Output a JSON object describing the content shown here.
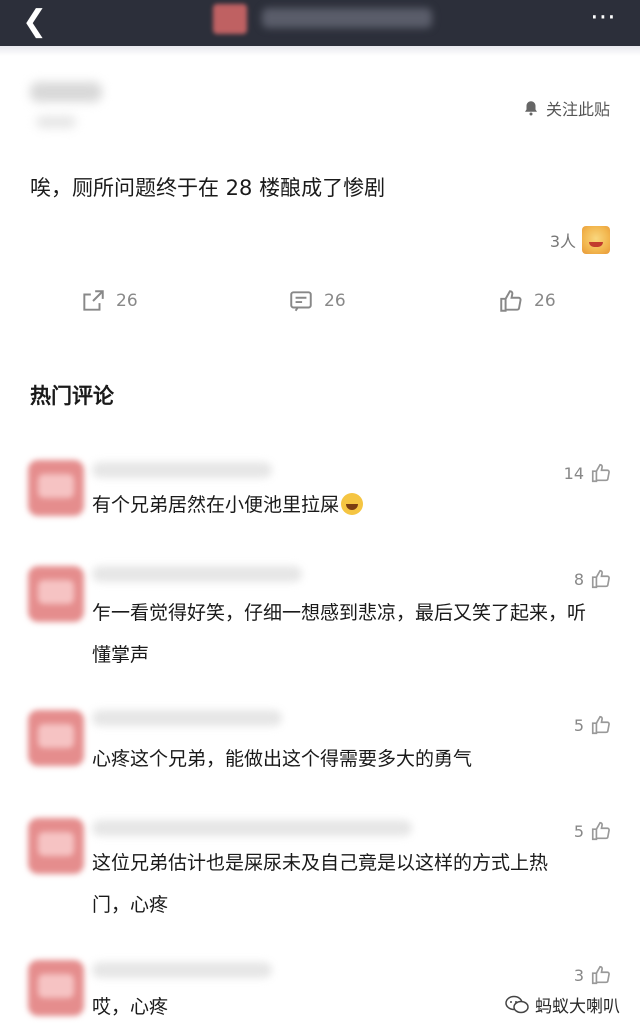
{
  "header": {
    "back_icon": "chevron-left-icon",
    "more_icon": "more-dots-icon"
  },
  "post": {
    "follow_label": "关注此贴",
    "text": "唉，厕所问题终于在 28 楼酿成了惨剧",
    "reaction_count": "3人",
    "actions": {
      "share_count": "26",
      "comment_count": "26",
      "like_count": "26"
    }
  },
  "hot_comments": {
    "title": "热门评论",
    "items": [
      {
        "likes": "14",
        "text": "有个兄弟居然在小便池里拉屎"
      },
      {
        "likes": "8",
        "text": "乍一看觉得好笑，仔细一想感到悲凉，最后又笑了起来，听懂掌声"
      },
      {
        "likes": "5",
        "text": "心疼这个兄弟，能做出这个得需要多大的勇气"
      },
      {
        "likes": "5",
        "text": "这位兄弟估计也是屎尿未及自己竟是以这样的方式上热门，心疼"
      },
      {
        "likes": "3",
        "text": "哎，心疼"
      }
    ]
  },
  "watermark": {
    "text": "蚂蚁大喇叭"
  },
  "colors": {
    "topbar": "#2c2f3a",
    "text": "#1a1a1a",
    "muted": "#888888"
  }
}
